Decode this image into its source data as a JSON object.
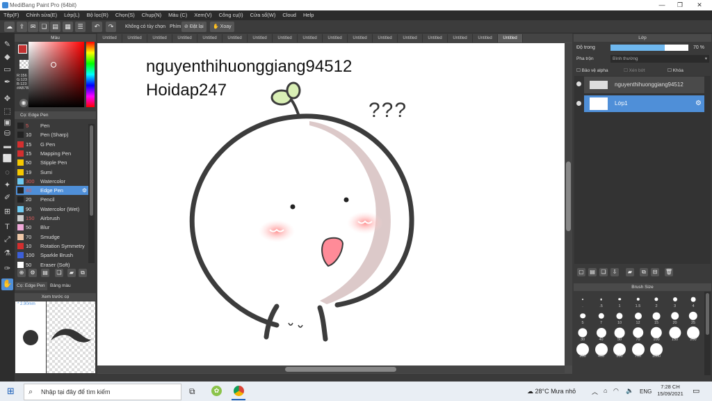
{
  "window": {
    "title": "MediBang Paint Pro (64bit)"
  },
  "menu": [
    "Tệp(F)",
    "Chỉnh sửa(E)",
    "Lớp(L)",
    "Bộ lọc(R)",
    "Chọn(S)",
    "Chụp(N)",
    "Màu (C)",
    "Xem(V)",
    "Công cụ(I)",
    "Cửa sổ(W)",
    "Cloud",
    "Help"
  ],
  "toolbar": {
    "no_option": "Không có tùy chọn",
    "keys_label": "Phím",
    "cancel": "Đặt lại",
    "rotate": "Xoay"
  },
  "color_panel": {
    "title": "Màu",
    "rgb": [
      "R:156",
      "G:123",
      "B:123"
    ],
    "hex": "#AB7B7B",
    "primary": "#c23030"
  },
  "brush_panel": {
    "title": "Cọ: Edge Pen",
    "items": [
      {
        "size": "5",
        "name": "Pen",
        "color": "#222222",
        "sizeColor": "#e05a5a"
      },
      {
        "size": "10",
        "name": "Pen (Sharp)",
        "color": "#222222"
      },
      {
        "size": "15",
        "name": "G Pen",
        "color": "#d32f2f"
      },
      {
        "size": "15",
        "name": "Mapping Pen",
        "color": "#d32f2f"
      },
      {
        "size": "50",
        "name": "Stipple Pen",
        "color": "#f6c800"
      },
      {
        "size": "19",
        "name": "Sumi",
        "color": "#f6c800"
      },
      {
        "size": "300",
        "name": "Watercolor",
        "color": "#6ec9f0",
        "sizeColor": "#e05a5a"
      },
      {
        "size": "40",
        "name": "Edge Pen",
        "color": "#222222",
        "sizeColor": "#e05a5a"
      },
      {
        "size": "20",
        "name": "Pencil",
        "color": "#222222"
      },
      {
        "size": "90",
        "name": "Watercolor (Wet)",
        "color": "#6ec9f0"
      },
      {
        "size": "150",
        "name": "Airbrush",
        "color": "#cfcfcf",
        "sizeColor": "#e05a5a"
      },
      {
        "size": "50",
        "name": "Blur",
        "color": "#f0a8d8"
      },
      {
        "size": "70",
        "name": "Smudge",
        "color": "#f0c8a8"
      },
      {
        "size": "10",
        "name": "Rotation Symmetry",
        "color": "#d32f2f"
      },
      {
        "size": "100",
        "name": "Sparkle Brush",
        "color": "#3c5fd8"
      },
      {
        "size": "50",
        "name": "Eraser (Soft)",
        "color": "#ffffff"
      }
    ],
    "tab_brush": "Cọ: Edge Pen",
    "tab_palette": "Bảng màu"
  },
  "preview": {
    "title": "Xem trước cọ",
    "size": "2.90mm"
  },
  "tabs": [
    "Untitled",
    "Untitled",
    "Untitled",
    "Untitled",
    "Untitled",
    "Untitled",
    "Untitled",
    "Untitled",
    "Untitled",
    "Untitled",
    "Untitled",
    "Untitled",
    "Untitled",
    "Untitled",
    "Untitled",
    "Untitled",
    "Untitled"
  ],
  "canvas": {
    "line1": "nguyenthihuonggiang94512",
    "line2": "Hoidap247",
    "marks": "???"
  },
  "layer_panel": {
    "title": "Lớp",
    "opacity_label": "Độ trong",
    "opacity_value": "70 %",
    "opacity_fraction": 0.7,
    "blend_label": "Pha trộn",
    "blend_value": "Bình thường",
    "protect_alpha": "Bảo vệ alpha",
    "clipping": "Xén bớt",
    "lock": "Khóa",
    "layers": [
      {
        "name": "nguyenthihuonggiang94512"
      },
      {
        "name": "Lớp1"
      }
    ]
  },
  "brush_size": {
    "title": "Brush Size",
    "sizes": [
      ".",
      ".5",
      "1",
      "1.5",
      "2",
      "3",
      "4",
      "5",
      "7",
      "10",
      "12",
      "15",
      "20",
      "25",
      "30",
      "40",
      "50",
      "70",
      "100",
      "150",
      "200",
      "300",
      "400",
      "500",
      "700",
      "1000"
    ]
  },
  "taskbar": {
    "search_placeholder": "Nhập tại đây để tìm kiếm",
    "weather": "28°C  Mưa nhỏ",
    "lang": "ENG",
    "time": "7:28 CH",
    "date": "15/09/2021"
  }
}
